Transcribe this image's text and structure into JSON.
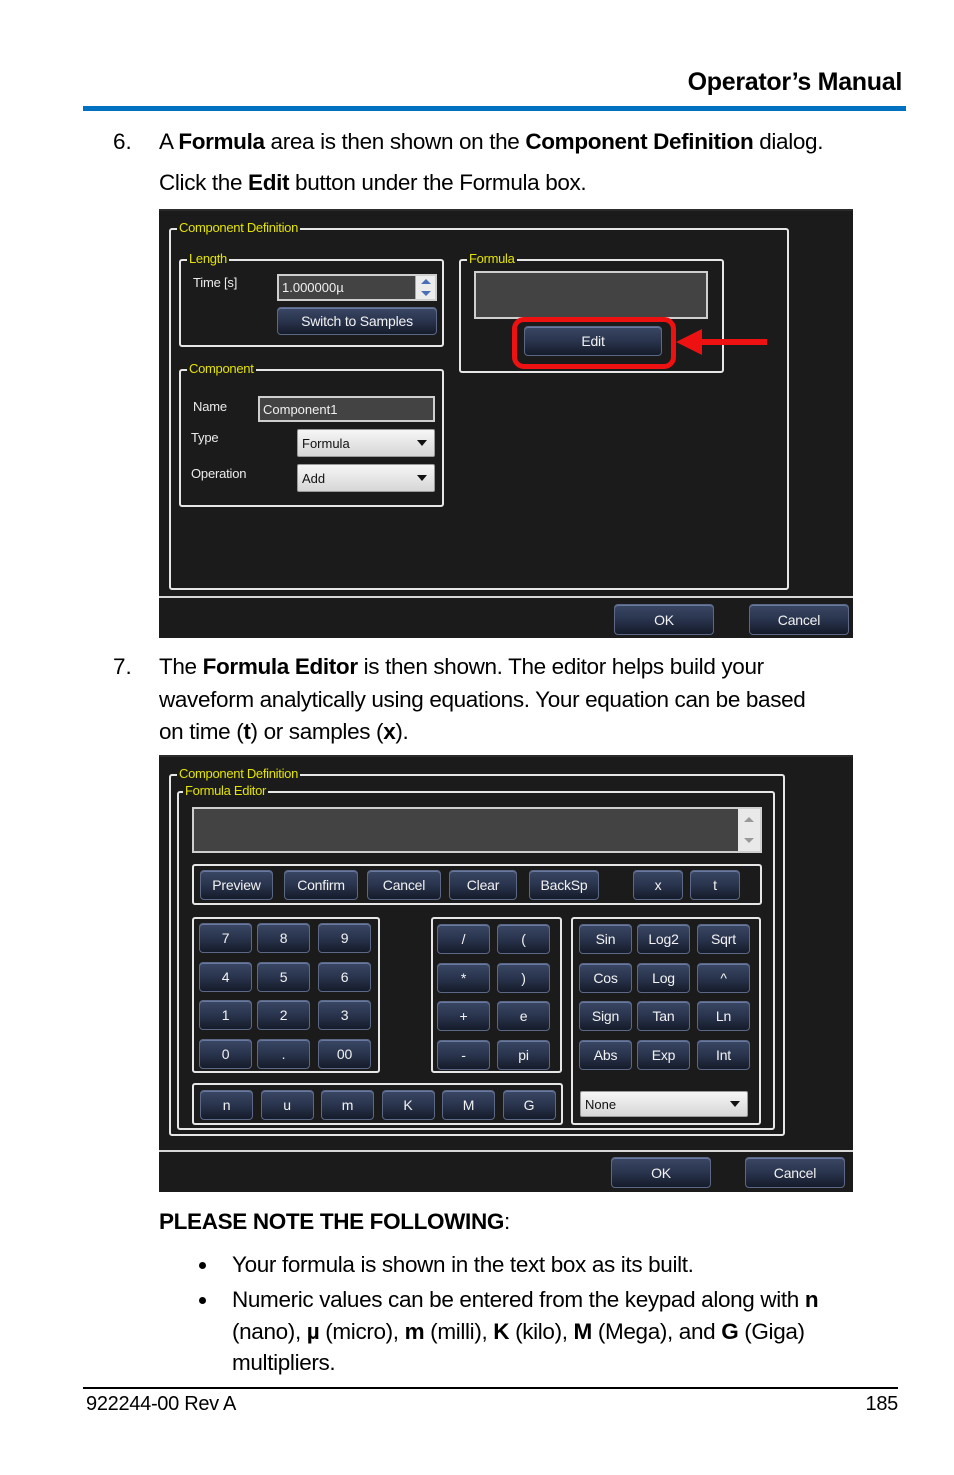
{
  "header": {
    "title": "Operator’s Manual",
    "rule_color": "#0070c0"
  },
  "step6": {
    "number": "6.",
    "line1": [
      {
        "t": "A ",
        "b": false
      },
      {
        "t": "Formula",
        "b": true
      },
      {
        "t": " area is then shown on the ",
        "b": false
      },
      {
        "t": "Component Definition",
        "b": true
      },
      {
        "t": " dialog.",
        "b": false
      }
    ],
    "line2": [
      {
        "t": "Click the ",
        "b": false
      },
      {
        "t": "Edit",
        "b": true
      },
      {
        "t": " button under the Formula box.",
        "b": false
      }
    ]
  },
  "dialog1": {
    "group_title": "Component Definition",
    "length": {
      "title": "Length",
      "time_label": "Time [s]",
      "time_value": "1.000000µ",
      "switch_button": "Switch to Samples"
    },
    "formula": {
      "title": "Formula",
      "value": "",
      "edit_button": "Edit",
      "highlight_color": "#ee1111"
    },
    "component": {
      "title": "Component",
      "name_label": "Name",
      "name_value": "Component1",
      "type_label": "Type",
      "type_value": "Formula",
      "operation_label": "Operation",
      "operation_value": "Add"
    },
    "ok_button": "OK",
    "cancel_button": "Cancel"
  },
  "step7": {
    "number": "7.",
    "lines": [
      [
        {
          "t": "The ",
          "b": false
        },
        {
          "t": "Formula Editor",
          "b": true
        },
        {
          "t": " is then shown. The editor helps build your",
          "b": false
        }
      ],
      [
        {
          "t": "waveform analytically using equations. Your equation can be based",
          "b": false
        }
      ],
      [
        {
          "t": "on time (",
          "b": false
        },
        {
          "t": "t",
          "b": true
        },
        {
          "t": ") or samples (",
          "b": false
        },
        {
          "t": "x",
          "b": true
        },
        {
          "t": ").",
          "b": false
        }
      ]
    ]
  },
  "dialog2": {
    "group_title": "Component Definition",
    "editor_title": "Formula Editor",
    "formula_value": "",
    "actions": [
      "Preview",
      "Confirm",
      "Cancel",
      "Clear",
      "BackSp"
    ],
    "variables": [
      "x",
      "t"
    ],
    "digits": [
      "7",
      "8",
      "9",
      "4",
      "5",
      "6",
      "1",
      "2",
      "3",
      "0",
      ".",
      "00"
    ],
    "operators": [
      "/",
      "(",
      "*",
      ")",
      "+",
      "e",
      "-",
      "pi"
    ],
    "functions": [
      "Sin",
      "Log2",
      "Sqrt",
      "Cos",
      "Log",
      "^",
      "Sign",
      "Tan",
      "Ln",
      "Abs",
      "Exp",
      "Int"
    ],
    "multipliers": [
      "n",
      "u",
      "m",
      "K",
      "M",
      "G"
    ],
    "preset_value": "None",
    "ok_button": "OK",
    "cancel_button": "Cancel"
  },
  "note": {
    "heading": "PLEASE NOTE THE FOLLOWING",
    "heading_suffix": ":",
    "bullets": [
      [
        {
          "t": "Your formula is shown in the text box as its built.",
          "b": false
        }
      ],
      [
        {
          "t": "Numeric values can be entered from the keypad along with ",
          "b": false
        },
        {
          "t": "n",
          "b": true
        }
      ],
      [
        {
          "t": "(nano), ",
          "b": false
        },
        {
          "t": "µ",
          "b": true
        },
        {
          "t": " (micro), ",
          "b": false
        },
        {
          "t": "m",
          "b": true
        },
        {
          "t": " (milli), ",
          "b": false
        },
        {
          "t": "K",
          "b": true
        },
        {
          "t": " (kilo), ",
          "b": false
        },
        {
          "t": "M",
          "b": true
        },
        {
          "t": " (Mega), and ",
          "b": false
        },
        {
          "t": "G",
          "b": true
        },
        {
          "t": " (Giga)",
          "b": false
        }
      ],
      [
        {
          "t": "multipliers.",
          "b": false
        }
      ]
    ]
  },
  "footer": {
    "doc_id": "922244-00 Rev A",
    "page": "185"
  }
}
